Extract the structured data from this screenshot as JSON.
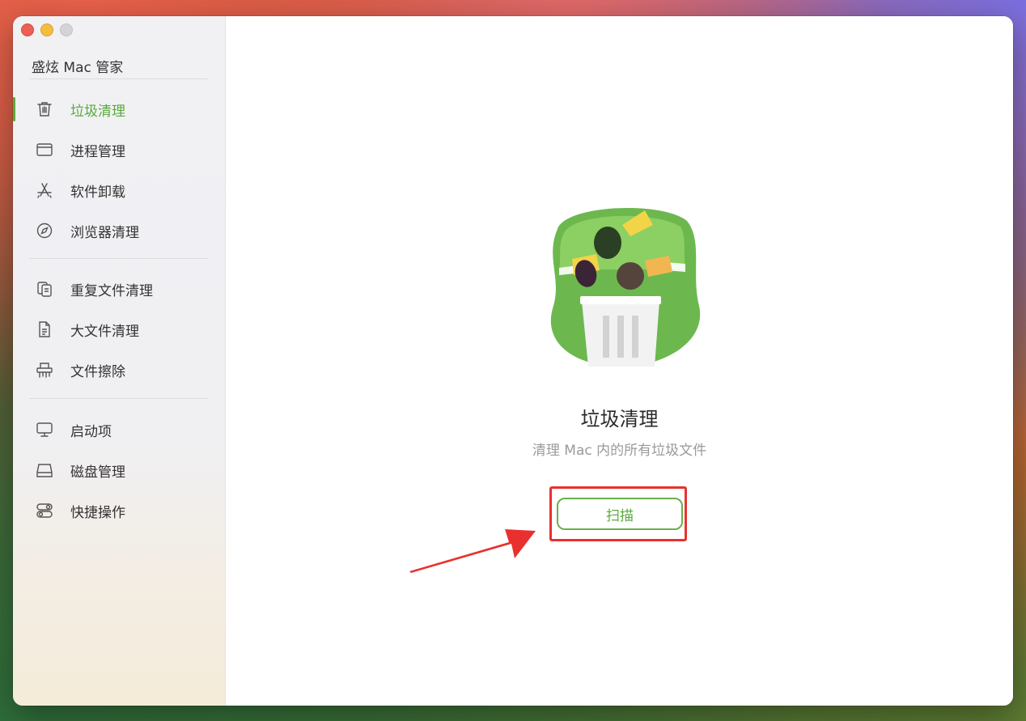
{
  "app": {
    "title": "盛炫 Mac 管家"
  },
  "sidebar": {
    "items": [
      {
        "label": "垃圾清理",
        "icon": "trash-icon",
        "active": true
      },
      {
        "label": "进程管理",
        "icon": "window-icon",
        "active": false
      },
      {
        "label": "软件卸载",
        "icon": "app-store-icon",
        "active": false
      },
      {
        "label": "浏览器清理",
        "icon": "compass-icon",
        "active": false
      },
      {
        "label": "重复文件清理",
        "icon": "duplicate-files-icon",
        "active": false
      },
      {
        "label": "大文件清理",
        "icon": "document-icon",
        "active": false
      },
      {
        "label": "文件擦除",
        "icon": "shredder-icon",
        "active": false
      },
      {
        "label": "启动项",
        "icon": "monitor-icon",
        "active": false
      },
      {
        "label": "磁盘管理",
        "icon": "disk-icon",
        "active": false
      },
      {
        "label": "快捷操作",
        "icon": "toggles-icon",
        "active": false
      }
    ]
  },
  "main": {
    "title": "垃圾清理",
    "subtitle": "清理 Mac 内的所有垃圾文件",
    "scan_label": "扫描"
  },
  "colors": {
    "accent": "#5aaa3c",
    "highlight": "#e8312f",
    "hero_green": "#6cb84e"
  }
}
